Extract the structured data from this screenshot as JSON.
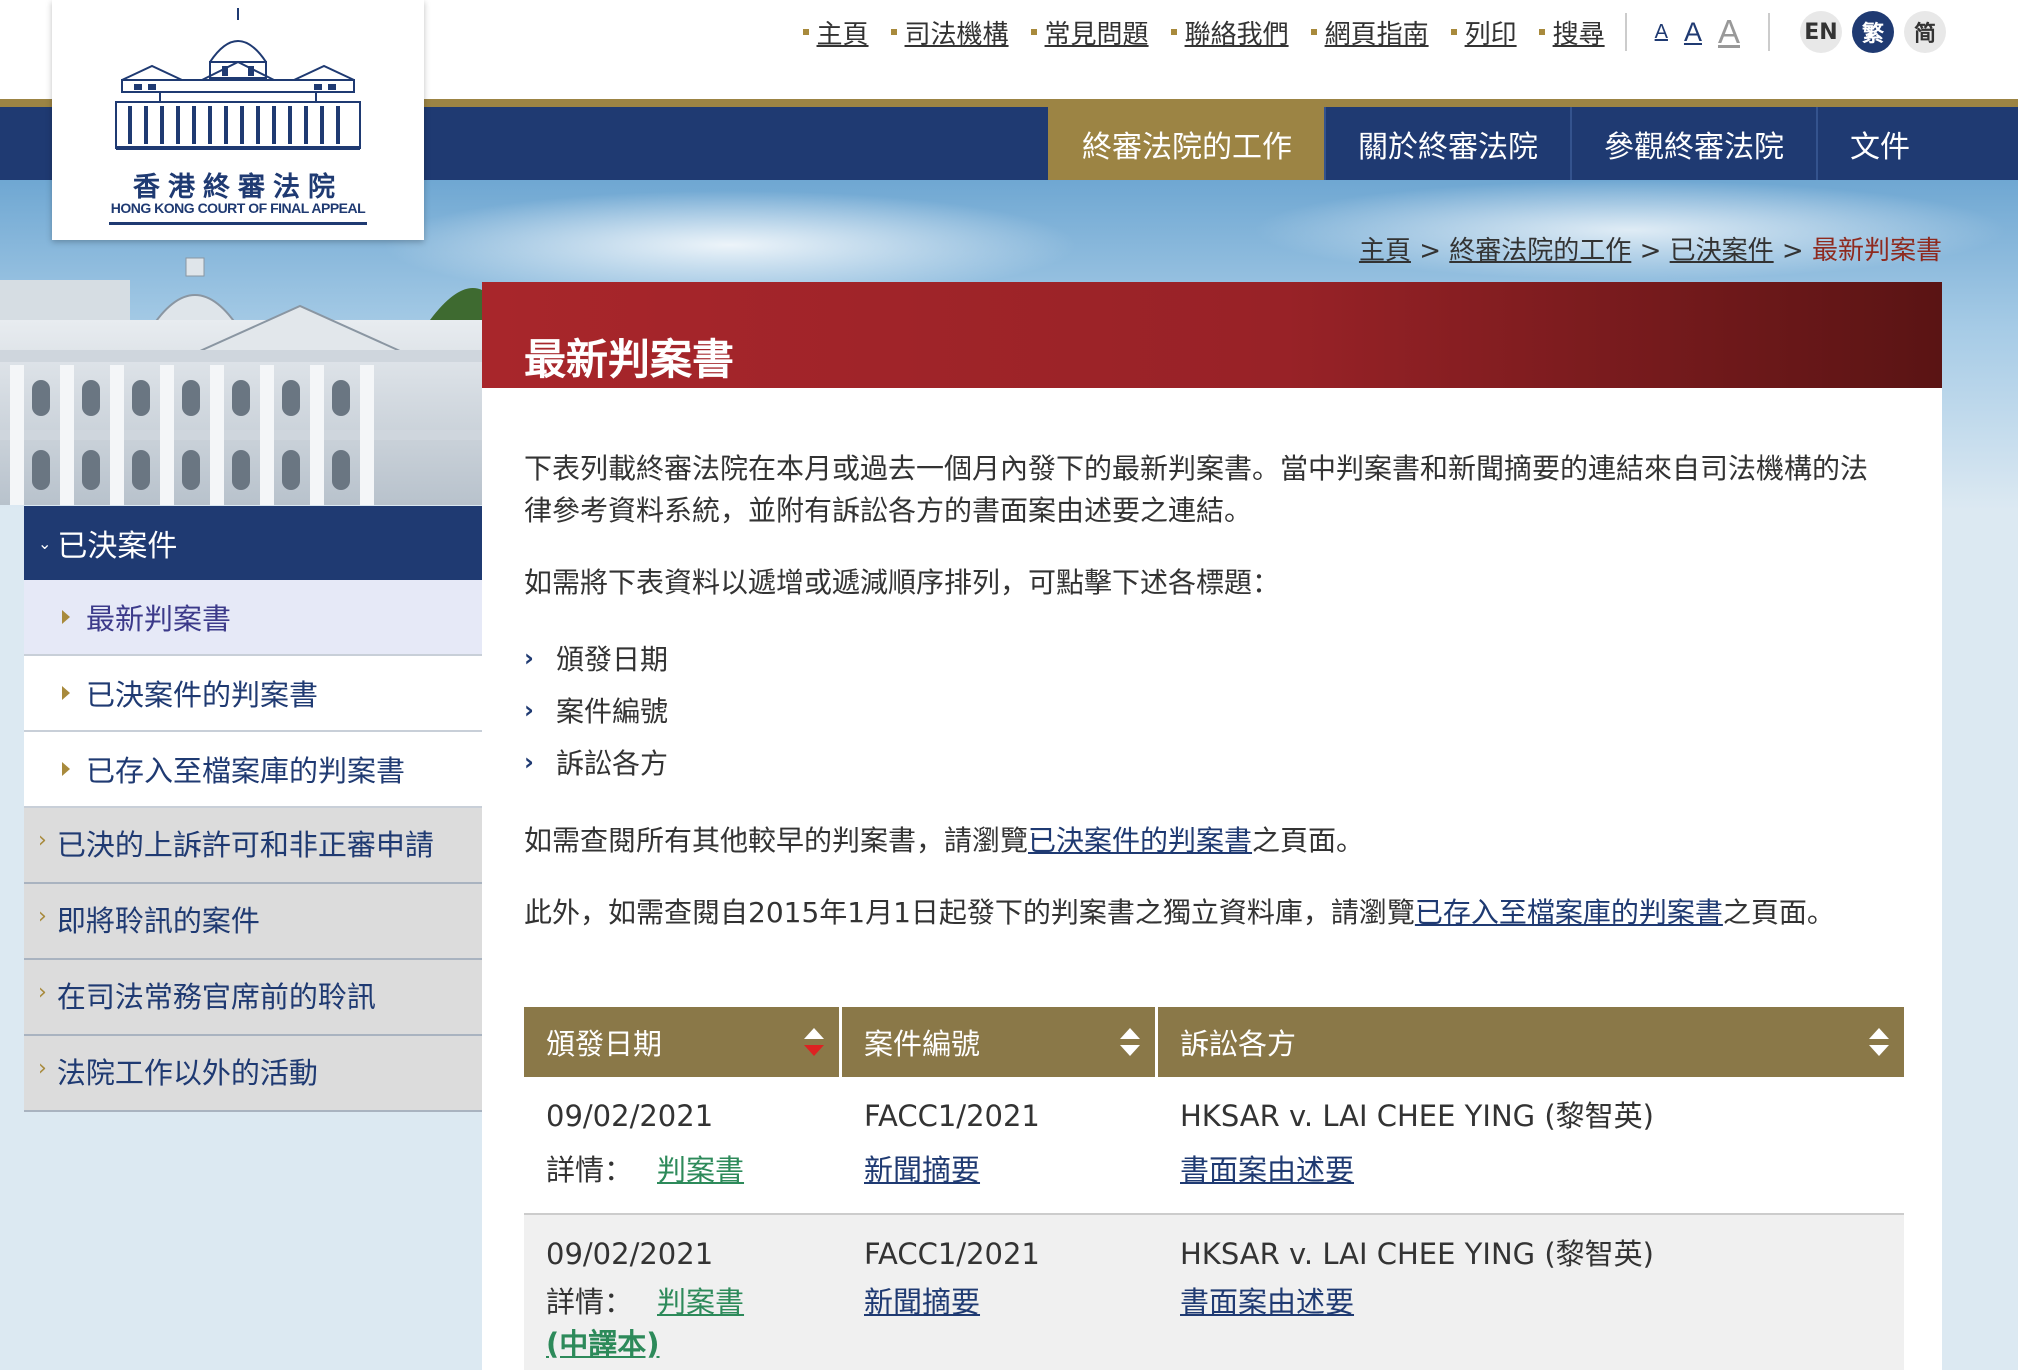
{
  "util_nav": [
    {
      "label": "主頁"
    },
    {
      "label": "司法機構"
    },
    {
      "label": "常見問題"
    },
    {
      "label": "聯絡我們"
    },
    {
      "label": "網頁指南"
    },
    {
      "label": "列印"
    },
    {
      "label": "搜尋"
    }
  ],
  "font_sizes": [
    "A",
    "A",
    "A"
  ],
  "languages": [
    "EN",
    "繁",
    "简"
  ],
  "logo": {
    "chinese": "香港終審法院",
    "english": "HONG KONG COURT OF FINAL APPEAL"
  },
  "main_nav": [
    {
      "label": "終審法院的工作"
    },
    {
      "label": "關於終審法院"
    },
    {
      "label": "參觀終審法院"
    },
    {
      "label": "文件"
    }
  ],
  "breadcrumb": {
    "home": "主頁",
    "level1": "終審法院的工作",
    "level2": "已決案件",
    "current": "最新判案書",
    "sep": ">"
  },
  "sidebar": {
    "section": "已決案件",
    "sub_items": [
      {
        "label": "最新判案書"
      },
      {
        "label": "已決案件的判案書"
      },
      {
        "label": "已存入至檔案庫的判案書"
      }
    ],
    "top_items": [
      {
        "label": "已決的上訴許可和非正審申請"
      },
      {
        "label": "即將聆訊的案件"
      },
      {
        "label": "在司法常務官席前的聆訊"
      },
      {
        "label": "法院工作以外的活動"
      }
    ]
  },
  "page": {
    "title": "最新判案書",
    "intro": "下表列載終審法院在本月或過去一個月內發下的最新判案書。當中判案書和新聞摘要的連結來自司法機構的法律參考資料系統，並附有訴訟各方的書面案由述要之連結。",
    "sort_intro": "如需將下表資料以遞增或遞減順序排列，可點擊下述各標題：",
    "sort_items": [
      "頒發日期",
      "案件編號",
      "訴訟各方"
    ],
    "older_pre": "如需查閱所有其他較早的判案書，請瀏覽",
    "older_link": "已決案件的判案書",
    "older_post": "之頁面。",
    "archive_pre": "此外，如需查閱自2015年1月1日起發下的判案書之獨立資料庫，請瀏覽",
    "archive_link": "已存入至檔案庫的判案書",
    "archive_post": "之頁面。"
  },
  "table": {
    "headers": [
      "頒發日期",
      "案件編號",
      "訴訟各方"
    ],
    "details_label": "詳情：",
    "rows": [
      {
        "date": "09/02/2021",
        "case_no": "FACC1/2021",
        "parties": "HKSAR v. LAI CHEE YING (黎智英)",
        "judgment": "判案書",
        "press": "新聞摘要",
        "cases": "書面案由述要"
      },
      {
        "date": "09/02/2021",
        "case_no": "FACC1/2021",
        "parties": "HKSAR v. LAI CHEE YING (黎智英)",
        "judgment": "判案書",
        "translation": "(中譯本)",
        "press": "新聞摘要",
        "cases": "書面案由述要"
      }
    ]
  },
  "colors": {
    "navy": "#1f3a72",
    "gold": "#9c8444",
    "red": "#a8262b"
  }
}
